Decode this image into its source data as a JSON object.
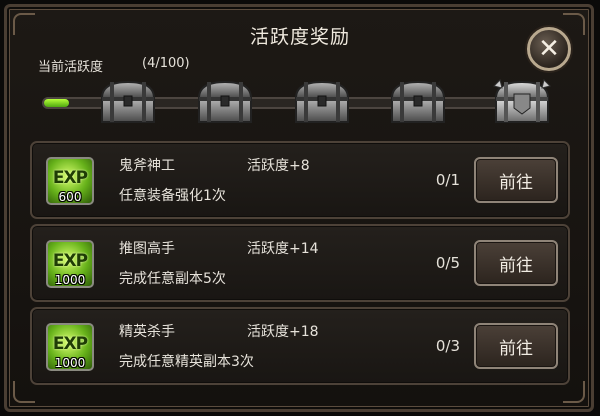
{
  "dialog": {
    "title": "活跃度奖励",
    "close_icon": "close-icon"
  },
  "activity": {
    "label": "当前活跃度",
    "value": "(4/100)",
    "progress": 0.04,
    "chests": [
      {
        "icon": "chest-icon",
        "state": "locked"
      },
      {
        "icon": "chest-icon",
        "state": "locked"
      },
      {
        "icon": "chest-icon",
        "state": "locked"
      },
      {
        "icon": "chest-icon",
        "state": "locked"
      },
      {
        "icon": "chest-icon",
        "state": "locked-special"
      }
    ]
  },
  "tasks": [
    {
      "icon_label": "EXP",
      "reward": "600",
      "name": "鬼斧神工",
      "activity": "活跃度+8",
      "description": "任意装备强化1次",
      "progress": "0/1",
      "button": "前往"
    },
    {
      "icon_label": "EXP",
      "reward": "1000",
      "name": "推图高手",
      "activity": "活跃度+14",
      "description": "完成任意副本5次",
      "progress": "0/5",
      "button": "前往"
    },
    {
      "icon_label": "EXP",
      "reward": "1000",
      "name": "精英杀手",
      "activity": "活跃度+18",
      "description": "完成任意精英副本3次",
      "progress": "0/3",
      "button": "前往"
    }
  ],
  "colors": {
    "progress_fill": "#7ed321",
    "panel_border": "#4d4238",
    "button_border": "#8f8478"
  }
}
